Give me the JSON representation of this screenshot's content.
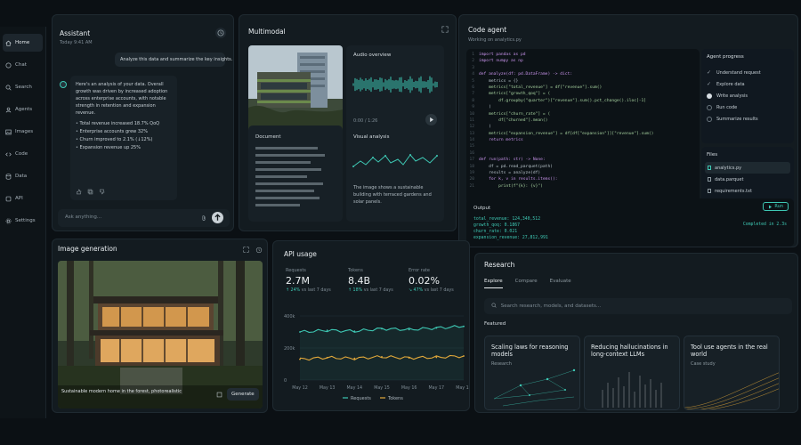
{
  "sidebar": {
    "items": [
      {
        "label": "Home",
        "icon": "home-icon"
      },
      {
        "label": "Chat",
        "icon": "chat-icon"
      },
      {
        "label": "Search",
        "icon": "search-icon"
      },
      {
        "label": "Agents",
        "icon": "agents-icon"
      },
      {
        "label": "Images",
        "icon": "image-icon"
      },
      {
        "label": "Code",
        "icon": "code-icon"
      },
      {
        "label": "Data",
        "icon": "database-icon"
      },
      {
        "label": "API",
        "icon": "api-icon"
      },
      {
        "label": "Settings",
        "icon": "gear-icon"
      }
    ]
  },
  "assistant": {
    "title": "Assistant",
    "time": "Today 9:41 AM",
    "user_msg": "Analyze this data and summarize the key insights.",
    "reply": "Here's an analysis of your data. Overall growth was driven by increased adoption across enterprise accounts, with notable strength in retention and expansion revenue.",
    "bullets": [
      "Total revenue increased 18.7% QoQ",
      "Enterprise accounts grew 32%",
      "Churn improved to 2.1% (↓12%)",
      "Expansion revenue up 25%"
    ],
    "placeholder": "Ask anything..."
  },
  "multimodal": {
    "title": "Multimodal",
    "audio_label": "Audio overview",
    "audio_time": "0:00 / 1:26",
    "doc_label": "Document",
    "visual_label": "Visual analysis",
    "visual_text": "The image shows a sustainable building with terraced gardens and solar panels."
  },
  "code_agent": {
    "title": "Code agent",
    "subtitle": "Working on analytics.py",
    "code": [
      "import pandas as pd",
      "import numpy as np",
      "",
      "def analyze(df: pd.DataFrame) -> dict:",
      "    metrics = {}",
      "    metrics[\"total_revenue\"] = df[\"revenue\"].sum()",
      "    metrics[\"growth_qoq\"] = (",
      "        df.groupby(\"quarter\")[\"revenue\"].sum().pct_change().iloc[-1]",
      "    )",
      "    metrics[\"churn_rate\"] = (",
      "        df[\"churned\"].mean()",
      "    )",
      "    metrics[\"expansion_revenue\"] = df[df[\"expansion\"]][\"revenue\"].sum()",
      "    return metrics",
      "",
      "",
      "def run(path: str) -> None:",
      "    df = pd.read_parquet(path)",
      "    results = analyze(df)",
      "    for k, v in results.items():",
      "        print(f\"{k}: {v}\")"
    ],
    "progress_title": "Agent progress",
    "steps": [
      {
        "label": "Understand request",
        "state": "done"
      },
      {
        "label": "Explore data",
        "state": "done"
      },
      {
        "label": "Write analysis",
        "state": "active"
      },
      {
        "label": "Run code",
        "state": "pending"
      },
      {
        "label": "Summarize results",
        "state": "pending"
      }
    ],
    "files_title": "Files",
    "files": [
      "analytics.py",
      "data.parquet",
      "requirements.txt"
    ],
    "output_title": "Output",
    "run_label": "Run",
    "output_lines": [
      "total_revenue: 124,340,512",
      "growth_qoq: 0.1867",
      "churn_rate: 0.021",
      "expansion_revenue: 27,812,991"
    ],
    "completed": "Completed in 2.3s"
  },
  "image_gen": {
    "title": "Image generation",
    "prompt": "Sustainable modern home in the forest, photorealistic",
    "generate_label": "Generate"
  },
  "api_usage": {
    "title": "API usage",
    "stats": [
      {
        "label": "Requests",
        "value": "2.7M",
        "delta": "↑ 24%",
        "note": "vs last 7 days"
      },
      {
        "label": "Tokens",
        "value": "8.4B",
        "delta": "↑ 18%",
        "note": "vs last 7 days"
      },
      {
        "label": "Error rate",
        "value": "0.02%",
        "delta": "↘ 47%",
        "note": "vs last 7 days"
      }
    ],
    "colors": {
      "requests": "#3ec8b4",
      "tokens": "#e3a93a"
    }
  },
  "chart_data": {
    "type": "line",
    "categories": [
      "May 12",
      "May 13",
      "May 14",
      "May 15",
      "May 16",
      "May 17",
      "May 18"
    ],
    "y_ticks": [
      "400k",
      "200k",
      "0"
    ],
    "ylim": [
      0,
      400000
    ],
    "series": [
      {
        "name": "Requests",
        "values": [
          300000,
          310000,
          305000,
          320000,
          315000,
          325000,
          335000
        ]
      },
      {
        "name": "Tokens",
        "values": [
          130000,
          140000,
          135000,
          145000,
          138000,
          142000,
          150000
        ]
      }
    ],
    "legend": "bottom"
  },
  "research": {
    "title": "Research",
    "tabs": [
      "Explore",
      "Compare",
      "Evaluate"
    ],
    "placeholder": "Search research, models, and datasets...",
    "featured_label": "Featured",
    "cards": [
      {
        "title": "Scaling laws for reasoning models",
        "category": "Research"
      },
      {
        "title": "Reducing hallucinations in long-context LLMs",
        "category": ""
      },
      {
        "title": "Tool use agents in the real world",
        "category": "Case study"
      }
    ]
  }
}
